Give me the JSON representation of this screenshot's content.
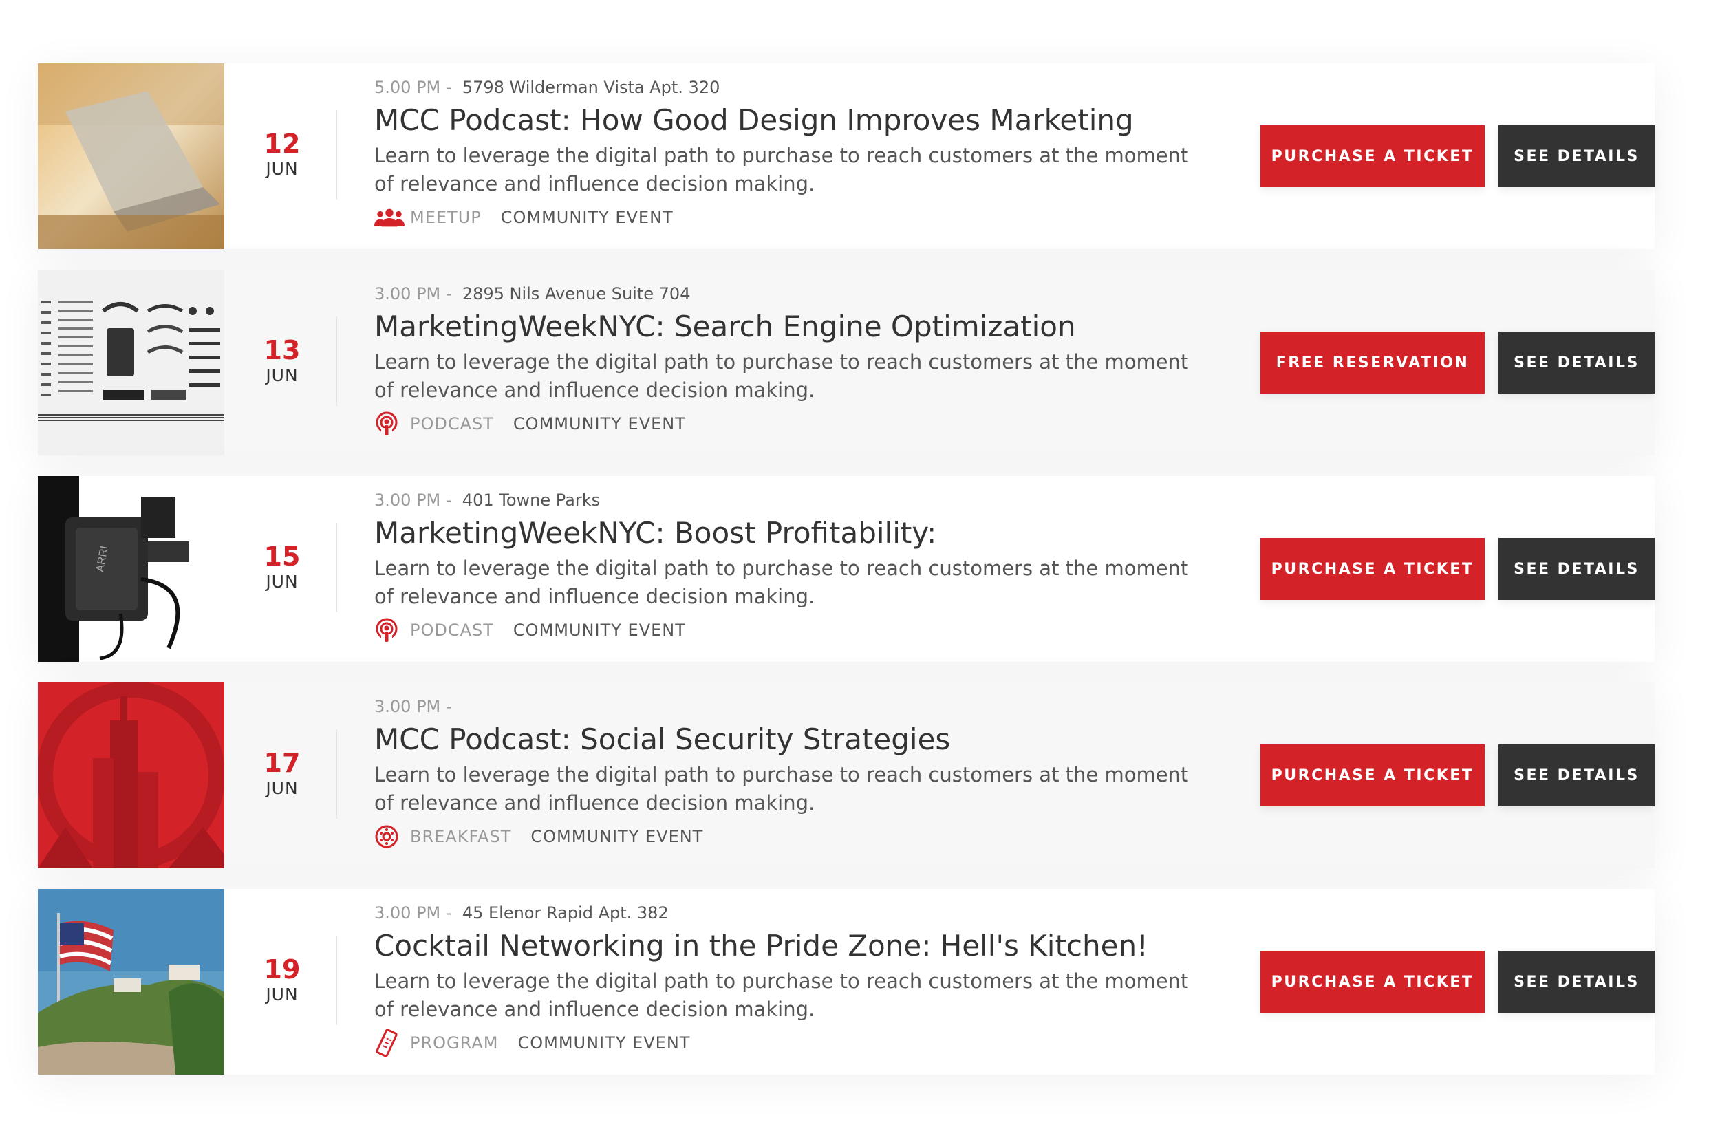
{
  "colors": {
    "accent": "#d42229",
    "dark": "#333333",
    "muted": "#999999",
    "text": "#555555"
  },
  "events": [
    {
      "image": "laptop-photo",
      "day": "12",
      "month": "JUN",
      "time": "5.00 PM -",
      "address": "5798 Wilderman Vista Apt. 320",
      "title": "MCC Podcast: How Good Design Improves Marketing",
      "description": "Learn to leverage the digital path to purchase to reach customers at the moment of relevance and influence decision making.",
      "type_icon": "people-icon",
      "type": "MEETUP",
      "category": "COMMUNITY EVENT",
      "primary_button": "PURCHASE A TICKET",
      "secondary_button": "SEE DETAILS"
    },
    {
      "image": "tools-flatlay-photo",
      "day": "13",
      "month": "JUN",
      "time": "3.00 PM -",
      "address": "2895 Nils Avenue Suite 704",
      "title": "MarketingWeekNYC: Search Engine Optimization",
      "description": "Learn to leverage the digital path to purchase to reach customers at the moment of relevance and influence decision making.",
      "type_icon": "podcast-icon",
      "type": "PODCAST",
      "category": "COMMUNITY EVENT",
      "primary_button": "FREE RESERVATION",
      "secondary_button": "SEE DETAILS"
    },
    {
      "image": "camera-photo",
      "day": "15",
      "month": "JUN",
      "time": "3.00 PM -",
      "address": "401 Towne Parks",
      "title": "MarketingWeekNYC: Boost Profitability:",
      "description": "Learn to leverage the digital path to purchase to reach customers at the moment of relevance and influence decision making.",
      "type_icon": "podcast-icon",
      "type": "PODCAST",
      "category": "COMMUNITY EVENT",
      "primary_button": "PURCHASE A TICKET",
      "secondary_button": "SEE DETAILS"
    },
    {
      "image": "red-logo-graphic",
      "day": "17",
      "month": "JUN",
      "time": "3.00 PM -",
      "address": "",
      "title": "MCC Podcast: Social Security Strategies",
      "description": "Learn to leverage the digital path to purchase to reach customers at the moment of relevance and influence decision making.",
      "type_icon": "breakfast-icon",
      "type": "BREAKFAST",
      "category": "COMMUNITY EVENT",
      "primary_button": "PURCHASE A TICKET",
      "secondary_button": "SEE DETAILS"
    },
    {
      "image": "flag-coast-photo",
      "day": "19",
      "month": "JUN",
      "time": "3.00 PM -",
      "address": "45 Elenor Rapid Apt. 382",
      "title": "Cocktail Networking in the Pride Zone: Hell's Kitchen!",
      "description": "Learn to leverage the digital path to purchase to reach customers at the moment of relevance and influence decision making.",
      "type_icon": "ticket-icon",
      "type": "PROGRAM",
      "category": "COMMUNITY EVENT",
      "primary_button": "PURCHASE A TICKET",
      "secondary_button": "SEE DETAILS"
    }
  ]
}
